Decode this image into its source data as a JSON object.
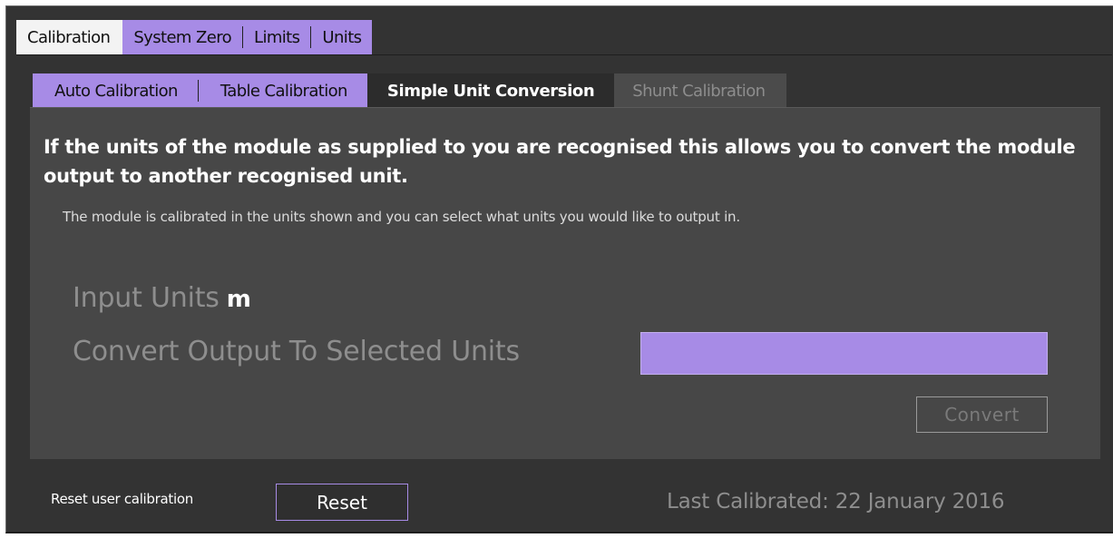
{
  "tabs_top": {
    "calibration": "Calibration",
    "system_zero": "System Zero",
    "limits": "Limits",
    "units": "Units"
  },
  "tabs_sub": {
    "auto": "Auto Calibration",
    "table": "Table Calibration",
    "simple": "Simple Unit Conversion",
    "shunt": "Shunt Calibration"
  },
  "panel": {
    "headline": "If the units of the module as supplied to you are recognised this allows you to convert the module output to another recognised unit.",
    "subline": "The module is calibrated in the units shown and you can select  what units you would like to output in.",
    "input_units_label": "Input Units",
    "input_units_value": "m",
    "convert_label": "Convert Output To Selected Units",
    "output_value": "",
    "convert_button": "Convert"
  },
  "footer": {
    "reset_label": "Reset user calibration",
    "reset_button": "Reset",
    "last_calibrated": "Last Calibrated: 22 January 2016"
  },
  "colors": {
    "accent": "#a78be6",
    "background": "#333333",
    "panel": "#474747"
  }
}
